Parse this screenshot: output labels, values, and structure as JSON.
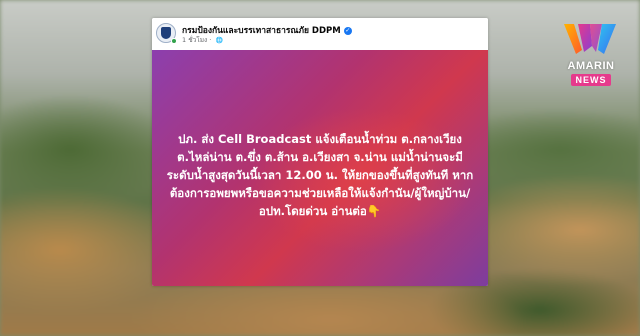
{
  "post": {
    "page_name": "กรมป้องกันและบรรเทาสาธารณภัย DDPM",
    "timestamp": "1 ชั่วโมง",
    "text": "ปภ. ส่ง Cell Broadcast แจ้งเตือนน้ำท่วม ต.กลางเวียง ต.ไหล่น่าน ต.ขึ่ง ต.ส้าน อ.เวียงสา จ.น่าน แม่น้ำน่านจะมีระดับน้ำสูงสุดวันนี้เวลา 12.00 น. ให้ยกของขึ้นที่สูงทันที หากต้องการอพยพหรือขอความช่วยเหลือให้แจ้งกำนัน/ผู้ใหญ่บ้าน/อปท.โดยด่วน อ่านต่อ👇",
    "verified_icon": "verified-badge-icon",
    "privacy_icon": "globe-icon"
  },
  "logo": {
    "brand": "AMARIN",
    "sub": "NEWS"
  },
  "colors": {
    "verified": "#1877f2",
    "news_badge": "#e63a8c",
    "post_bg_start": "#8c3fae",
    "post_bg_mid": "#d0384e"
  }
}
